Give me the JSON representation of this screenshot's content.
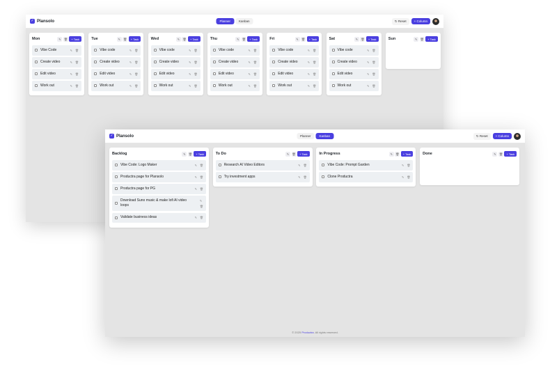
{
  "app": {
    "name": "Plansolo"
  },
  "toggle": {
    "planner": "Planner",
    "kanban": "Kanban"
  },
  "actions": {
    "reset": "↻ Reset",
    "add_column": "+ Column"
  },
  "column_actions": {
    "add_task": "+ Task"
  },
  "planner": {
    "columns": [
      {
        "title": "Mon",
        "tasks": [
          "Vibe Code",
          "Create video",
          "Edit video",
          "Work out"
        ]
      },
      {
        "title": "Tue",
        "tasks": [
          "Vibe code",
          "Create video",
          "Edit video",
          "Work out"
        ]
      },
      {
        "title": "Wed",
        "tasks": [
          "Vibe code",
          "Create video",
          "Edit video",
          "Work out"
        ]
      },
      {
        "title": "Thu",
        "tasks": [
          "Vibe code",
          "Create video",
          "Edit video",
          "Work out"
        ]
      },
      {
        "title": "Fri",
        "tasks": [
          "Vibe code",
          "Create video",
          "Edit video",
          "Work out"
        ]
      },
      {
        "title": "Sat",
        "tasks": [
          "Vibe code",
          "Create video",
          "Edit video",
          "Work out"
        ]
      },
      {
        "title": "Sun",
        "tasks": []
      }
    ]
  },
  "kanban": {
    "columns": [
      {
        "title": "Backlog",
        "tasks": [
          "Vibe Code: Logo Maker",
          "Productra page for Plansolo",
          "Productra page for PG",
          "Download Suno music & make lofi AI video loops",
          "Validate business ideas"
        ]
      },
      {
        "title": "To Do",
        "tasks": [
          "Research AI Video Editors",
          "Try investment apps"
        ]
      },
      {
        "title": "In Progress",
        "tasks": [
          "Vibe Code: Prompt Garden",
          "Clone Productra"
        ]
      },
      {
        "title": "Done",
        "tasks": []
      }
    ]
  },
  "footer": {
    "prefix": "© 2025",
    "link": "Productra",
    "suffix": ". All rights reserved."
  },
  "colors": {
    "accent": "#4a3fe0",
    "board_bg": "#e4e4e4",
    "task_bg": "#edf0f3"
  },
  "icons": {
    "edit": "pencil-icon",
    "delete": "trash-icon",
    "brand": "checkbox-icon"
  }
}
